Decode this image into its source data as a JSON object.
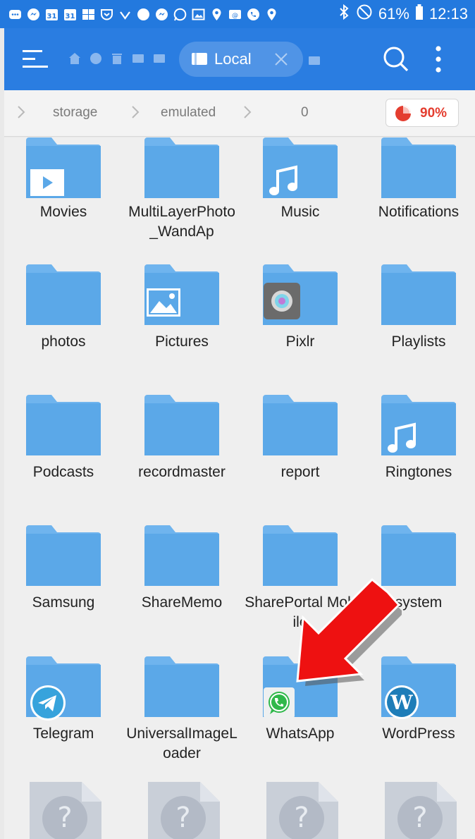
{
  "status_bar": {
    "battery": "61%",
    "time": "12:13",
    "icons": [
      "chat-bubble-icon",
      "messenger-icon",
      "calendar-icon",
      "calendar-icon",
      "gallery-icon",
      "pocket-icon",
      "check-icon",
      "hangouts-icon",
      "messenger-icon",
      "whatsapp-icon",
      "image-icon",
      "location-icon",
      "email-icon",
      "phone-icon",
      "location-icon"
    ],
    "calendar_day": "31"
  },
  "toolbar": {
    "tab_label": "Local",
    "quick_icons": [
      "home-icon",
      "network-icon",
      "trash-icon",
      "tab-icon",
      "tab-icon"
    ]
  },
  "breadcrumb": {
    "items": [
      "storage",
      "emulated",
      "0"
    ],
    "storage_used": "90%"
  },
  "folders": [
    {
      "name": "Movies",
      "badge": "video-icon"
    },
    {
      "name": "MultiLayerPhoto_WandAp",
      "badge": ""
    },
    {
      "name": "Music",
      "badge": "music-note-icon"
    },
    {
      "name": "Notifications",
      "badge": ""
    },
    {
      "name": "photos",
      "badge": ""
    },
    {
      "name": "Pictures",
      "badge": "image-icon"
    },
    {
      "name": "Pixlr",
      "badge": "pixlr-app-icon"
    },
    {
      "name": "Playlists",
      "badge": ""
    },
    {
      "name": "Podcasts",
      "badge": ""
    },
    {
      "name": "recordmaster",
      "badge": ""
    },
    {
      "name": "report",
      "badge": ""
    },
    {
      "name": "Ringtones",
      "badge": "music-note-icon"
    },
    {
      "name": "Samsung",
      "badge": ""
    },
    {
      "name": "ShareMemo",
      "badge": ""
    },
    {
      "name": "SharePortal Mobile",
      "badge": ""
    },
    {
      "name": "system",
      "badge": ""
    },
    {
      "name": "Telegram",
      "badge": "telegram-icon"
    },
    {
      "name": "UniversalImageLoader",
      "badge": ""
    },
    {
      "name": "WhatsApp",
      "badge": "whatsapp-icon"
    },
    {
      "name": "WordPress",
      "badge": "wordpress-icon"
    }
  ],
  "unknown_files": [
    "?",
    "?",
    "?",
    "?"
  ],
  "colors": {
    "status_bar": "#2379de",
    "toolbar": "#2a7de1",
    "folder": "#5ba8e8",
    "folder_tab": "#6fb4ee",
    "arrow": "#ee1111",
    "usage": "#e43d2f"
  }
}
